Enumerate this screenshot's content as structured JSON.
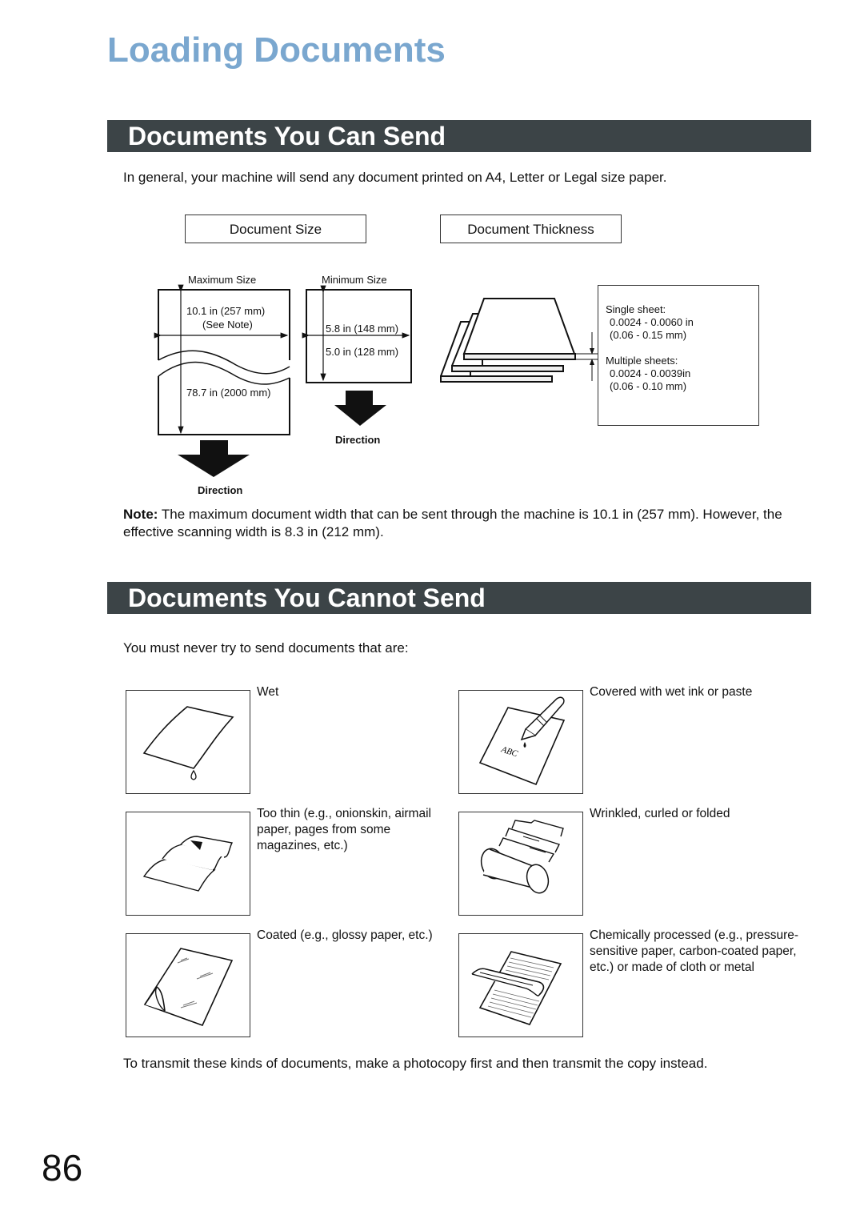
{
  "page": {
    "title": "Loading Documents",
    "page_number": "86"
  },
  "can_send": {
    "heading": "Documents You Can Send",
    "intro": "In general, your machine will send any document printed on A4, Letter or Legal size paper.",
    "size_label": "Document Size",
    "thickness_label": "Document Thickness",
    "max_size": {
      "label": "Maximum Size",
      "width": "10.1 in (257 mm)",
      "width_note": "(See Note)",
      "length": "78.7 in (2000 mm)",
      "direction": "Direction"
    },
    "min_size": {
      "label": "Minimum Size",
      "width": "5.8 in (148 mm)",
      "length": "5.0 in (128 mm)",
      "direction": "Direction"
    },
    "thickness": {
      "single_label": "Single sheet:",
      "single_in": "0.0024 - 0.0060 in",
      "single_mm": "(0.06 - 0.15 mm)",
      "multiple_label": "Multiple sheets:",
      "multiple_in": "0.0024 - 0.0039in",
      "multiple_mm": "(0.06 - 0.10 mm)"
    },
    "note_label": "Note:",
    "note_text": " The maximum document width that can be sent through the machine is 10.1 in (257 mm). However, the effective scanning width is 8.3 in (212 mm)."
  },
  "cannot_send": {
    "heading": "Documents You Cannot Send",
    "intro": "You must never try to send documents that are:",
    "items": [
      {
        "icon": "wet-paper-icon",
        "text": "Wet"
      },
      {
        "icon": "wet-ink-pen-icon",
        "text": "Covered with wet ink or paste",
        "sample_text": "ABC"
      },
      {
        "icon": "thin-paper-icon",
        "text": "Too thin (e.g., onionskin, airmail paper, pages from some magazines, etc.)"
      },
      {
        "icon": "wrinkled-paper-icon",
        "text": "Wrinkled, curled or folded"
      },
      {
        "icon": "coated-paper-icon",
        "text": "Coated (e.g., glossy paper, etc.)"
      },
      {
        "icon": "chemical-paper-icon",
        "text": "Chemically processed (e.g., pressure-sensitive paper, carbon-coated paper, etc.) or made of cloth or metal"
      }
    ],
    "footer": "To transmit these kinds of documents, make a photocopy first and then transmit the copy instead."
  }
}
